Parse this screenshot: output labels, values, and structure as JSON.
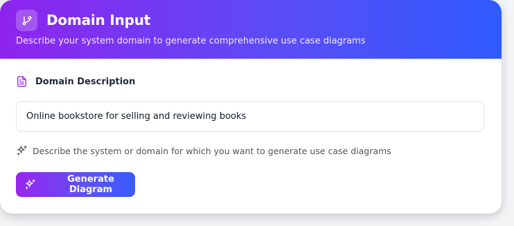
{
  "header": {
    "title": "Domain Input",
    "subtitle": "Describe your system domain to generate comprehensive use case diagrams",
    "icon": "git-branch-icon"
  },
  "domain": {
    "label": "Domain Description",
    "label_icon": "document-icon",
    "value": "Online bookstore for selling and reviewing books",
    "hint": "Describe the system or domain for which you want to generate use case diagrams",
    "hint_icon": "sparkles-icon"
  },
  "action": {
    "generate_label": "Generate Diagram",
    "icon": "sparkles-icon"
  },
  "colors": {
    "gradient_start": "#8f24ef",
    "gradient_end": "#2f5bff",
    "label_icon": "#9b30e8"
  }
}
